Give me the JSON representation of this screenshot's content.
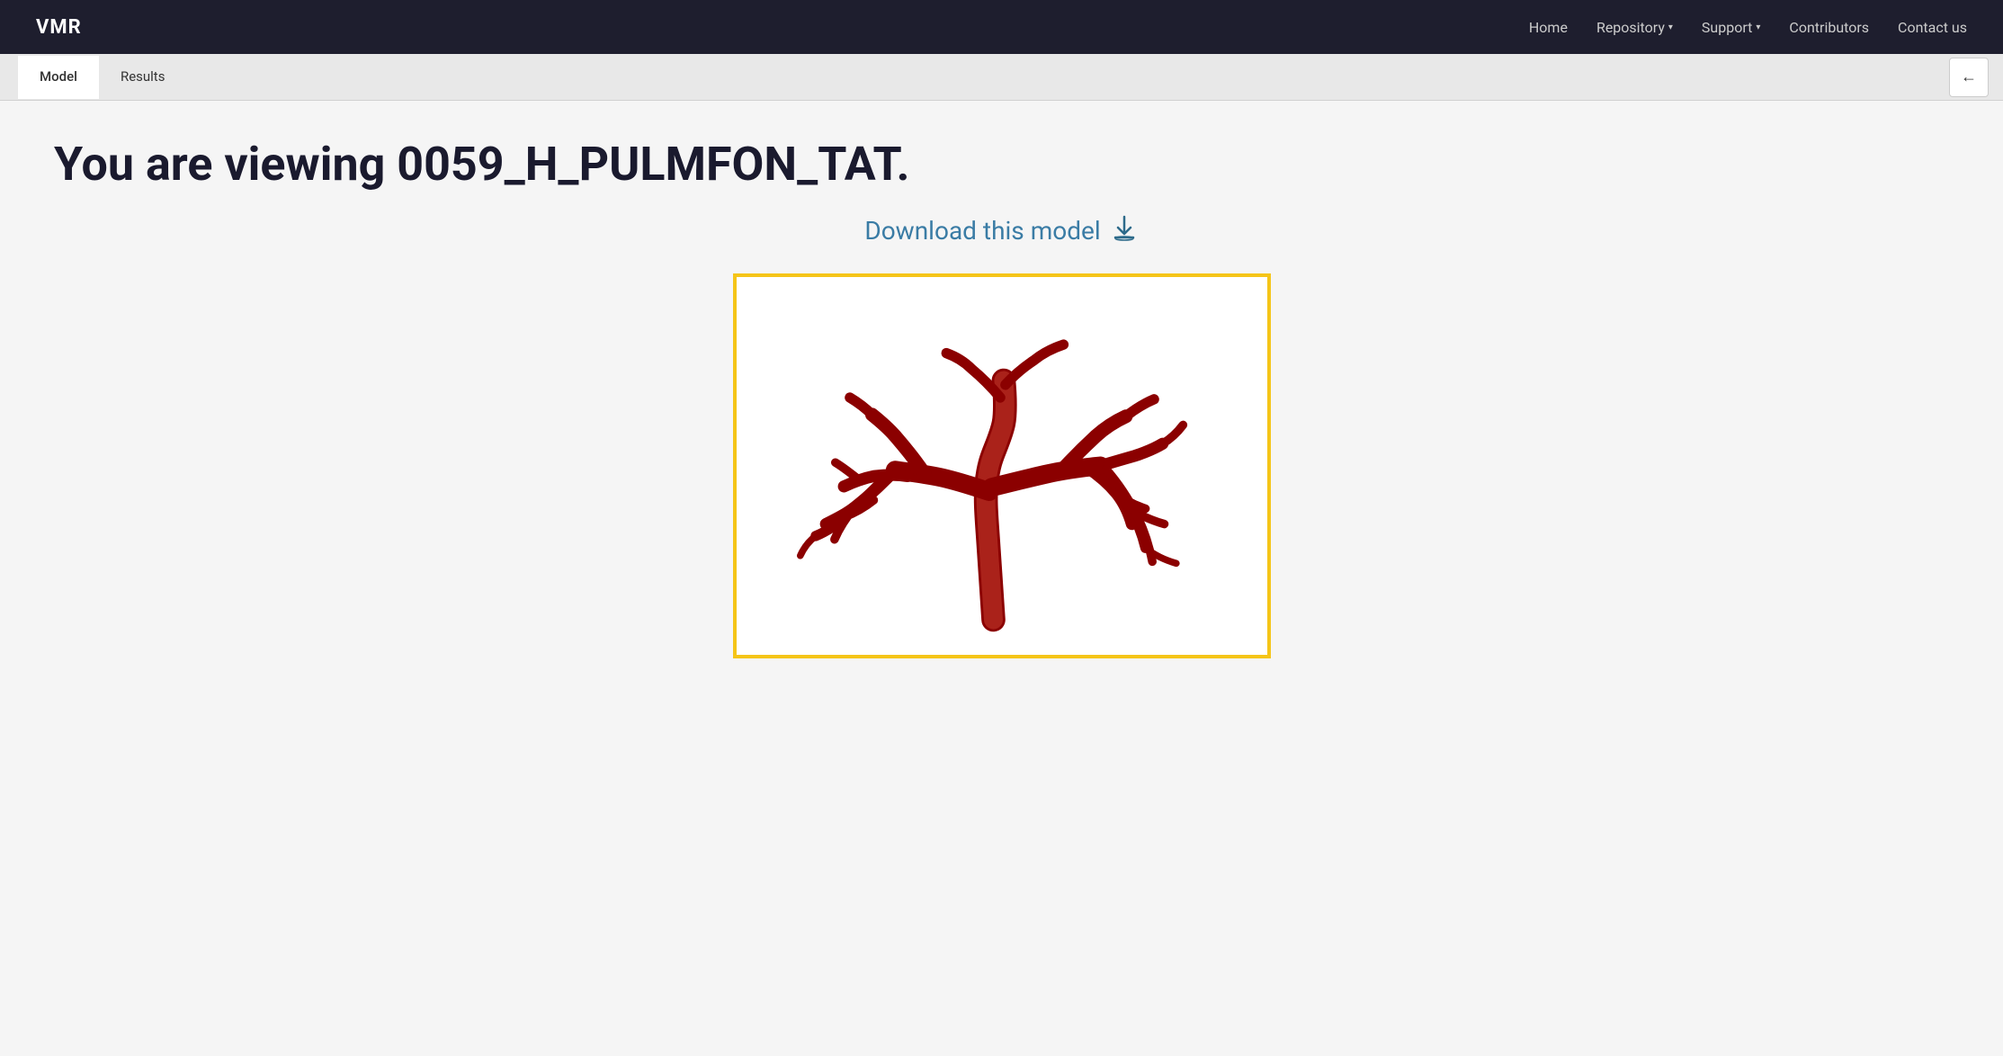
{
  "brand": "VMR",
  "navbar": {
    "links": [
      {
        "label": "Home",
        "hasDropdown": false
      },
      {
        "label": "Repository",
        "hasDropdown": true
      },
      {
        "label": "Support",
        "hasDropdown": true
      },
      {
        "label": "Contributors",
        "hasDropdown": false
      },
      {
        "label": "Contact us",
        "hasDropdown": false
      }
    ]
  },
  "tabs": [
    {
      "label": "Model",
      "active": true
    },
    {
      "label": "Results",
      "active": false
    }
  ],
  "page": {
    "viewing_prefix": "You are viewing ",
    "model_id": "0059_H_PULMFON_TAT.",
    "download_label": "Download this model",
    "back_arrow": "←"
  }
}
